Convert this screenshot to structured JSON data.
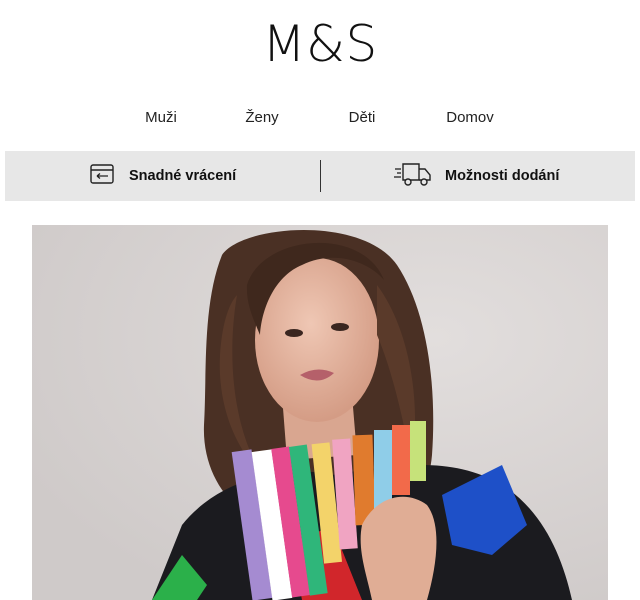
{
  "brand": {
    "logo_text": "M&S"
  },
  "nav": {
    "items": [
      {
        "label": "Muži"
      },
      {
        "label": "Ženy"
      },
      {
        "label": "Děti"
      },
      {
        "label": "Domov"
      }
    ]
  },
  "services": {
    "returns": {
      "label": "Snadné vrácení",
      "icon": "return-tag-icon"
    },
    "delivery": {
      "label": "Možnosti dodání",
      "icon": "delivery-truck-icon"
    }
  },
  "hero": {
    "image": "woman-wearing-striped-scarf-photo",
    "colors": {
      "background": "#d8d4d3",
      "sweater": "#1b1b1f",
      "accent_blue": "#1e50c8",
      "accent_red": "#d1262b"
    }
  }
}
